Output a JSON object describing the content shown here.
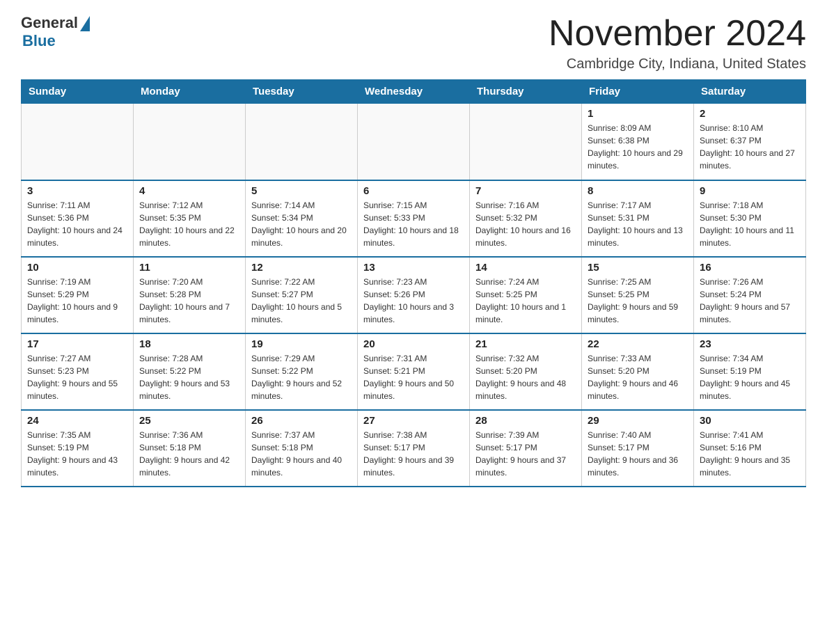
{
  "header": {
    "logo_general": "General",
    "logo_blue": "Blue",
    "month_title": "November 2024",
    "location": "Cambridge City, Indiana, United States"
  },
  "days_of_week": [
    "Sunday",
    "Monday",
    "Tuesday",
    "Wednesday",
    "Thursday",
    "Friday",
    "Saturday"
  ],
  "weeks": [
    [
      {
        "day": "",
        "info": ""
      },
      {
        "day": "",
        "info": ""
      },
      {
        "day": "",
        "info": ""
      },
      {
        "day": "",
        "info": ""
      },
      {
        "day": "",
        "info": ""
      },
      {
        "day": "1",
        "info": "Sunrise: 8:09 AM\nSunset: 6:38 PM\nDaylight: 10 hours and 29 minutes."
      },
      {
        "day": "2",
        "info": "Sunrise: 8:10 AM\nSunset: 6:37 PM\nDaylight: 10 hours and 27 minutes."
      }
    ],
    [
      {
        "day": "3",
        "info": "Sunrise: 7:11 AM\nSunset: 5:36 PM\nDaylight: 10 hours and 24 minutes."
      },
      {
        "day": "4",
        "info": "Sunrise: 7:12 AM\nSunset: 5:35 PM\nDaylight: 10 hours and 22 minutes."
      },
      {
        "day": "5",
        "info": "Sunrise: 7:14 AM\nSunset: 5:34 PM\nDaylight: 10 hours and 20 minutes."
      },
      {
        "day": "6",
        "info": "Sunrise: 7:15 AM\nSunset: 5:33 PM\nDaylight: 10 hours and 18 minutes."
      },
      {
        "day": "7",
        "info": "Sunrise: 7:16 AM\nSunset: 5:32 PM\nDaylight: 10 hours and 16 minutes."
      },
      {
        "day": "8",
        "info": "Sunrise: 7:17 AM\nSunset: 5:31 PM\nDaylight: 10 hours and 13 minutes."
      },
      {
        "day": "9",
        "info": "Sunrise: 7:18 AM\nSunset: 5:30 PM\nDaylight: 10 hours and 11 minutes."
      }
    ],
    [
      {
        "day": "10",
        "info": "Sunrise: 7:19 AM\nSunset: 5:29 PM\nDaylight: 10 hours and 9 minutes."
      },
      {
        "day": "11",
        "info": "Sunrise: 7:20 AM\nSunset: 5:28 PM\nDaylight: 10 hours and 7 minutes."
      },
      {
        "day": "12",
        "info": "Sunrise: 7:22 AM\nSunset: 5:27 PM\nDaylight: 10 hours and 5 minutes."
      },
      {
        "day": "13",
        "info": "Sunrise: 7:23 AM\nSunset: 5:26 PM\nDaylight: 10 hours and 3 minutes."
      },
      {
        "day": "14",
        "info": "Sunrise: 7:24 AM\nSunset: 5:25 PM\nDaylight: 10 hours and 1 minute."
      },
      {
        "day": "15",
        "info": "Sunrise: 7:25 AM\nSunset: 5:25 PM\nDaylight: 9 hours and 59 minutes."
      },
      {
        "day": "16",
        "info": "Sunrise: 7:26 AM\nSunset: 5:24 PM\nDaylight: 9 hours and 57 minutes."
      }
    ],
    [
      {
        "day": "17",
        "info": "Sunrise: 7:27 AM\nSunset: 5:23 PM\nDaylight: 9 hours and 55 minutes."
      },
      {
        "day": "18",
        "info": "Sunrise: 7:28 AM\nSunset: 5:22 PM\nDaylight: 9 hours and 53 minutes."
      },
      {
        "day": "19",
        "info": "Sunrise: 7:29 AM\nSunset: 5:22 PM\nDaylight: 9 hours and 52 minutes."
      },
      {
        "day": "20",
        "info": "Sunrise: 7:31 AM\nSunset: 5:21 PM\nDaylight: 9 hours and 50 minutes."
      },
      {
        "day": "21",
        "info": "Sunrise: 7:32 AM\nSunset: 5:20 PM\nDaylight: 9 hours and 48 minutes."
      },
      {
        "day": "22",
        "info": "Sunrise: 7:33 AM\nSunset: 5:20 PM\nDaylight: 9 hours and 46 minutes."
      },
      {
        "day": "23",
        "info": "Sunrise: 7:34 AM\nSunset: 5:19 PM\nDaylight: 9 hours and 45 minutes."
      }
    ],
    [
      {
        "day": "24",
        "info": "Sunrise: 7:35 AM\nSunset: 5:19 PM\nDaylight: 9 hours and 43 minutes."
      },
      {
        "day": "25",
        "info": "Sunrise: 7:36 AM\nSunset: 5:18 PM\nDaylight: 9 hours and 42 minutes."
      },
      {
        "day": "26",
        "info": "Sunrise: 7:37 AM\nSunset: 5:18 PM\nDaylight: 9 hours and 40 minutes."
      },
      {
        "day": "27",
        "info": "Sunrise: 7:38 AM\nSunset: 5:17 PM\nDaylight: 9 hours and 39 minutes."
      },
      {
        "day": "28",
        "info": "Sunrise: 7:39 AM\nSunset: 5:17 PM\nDaylight: 9 hours and 37 minutes."
      },
      {
        "day": "29",
        "info": "Sunrise: 7:40 AM\nSunset: 5:17 PM\nDaylight: 9 hours and 36 minutes."
      },
      {
        "day": "30",
        "info": "Sunrise: 7:41 AM\nSunset: 5:16 PM\nDaylight: 9 hours and 35 minutes."
      }
    ]
  ]
}
